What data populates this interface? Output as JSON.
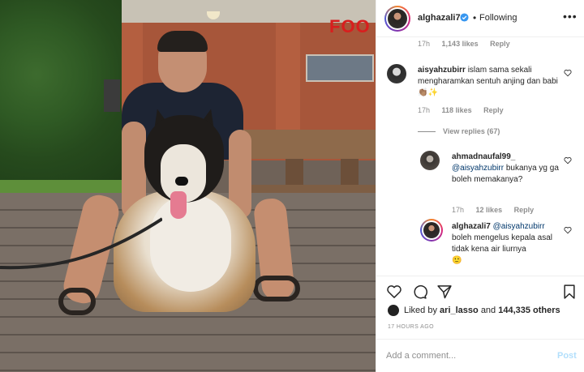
{
  "header": {
    "username": "alghazali7",
    "separator": "•",
    "follow_status": "Following",
    "more_label": "•••"
  },
  "comments": {
    "top_meta": {
      "time": "17h",
      "likes": "1,143 likes",
      "reply": "Reply"
    },
    "items": [
      {
        "username": "aisyahzubirr",
        "text": "islam sama sekali mengharamkan sentuh anjing dan babi",
        "emoji": "👏🏽✨",
        "time": "17h",
        "likes": "118 likes",
        "reply": "Reply",
        "view_replies": "View replies (67)"
      },
      {
        "username": "ahmadnaufal99_",
        "mention": "@aisyahzubirr",
        "text": "bukanya yg ga boleh memakanya?",
        "time": "17h",
        "likes": "12 likes",
        "reply": "Reply"
      },
      {
        "username": "alghazali7",
        "mention": "@aisyahzubirr",
        "text": "boleh mengelus kepala asal tidak kena air liurnya",
        "emoji": "🙂"
      }
    ]
  },
  "actions": {
    "liked_by_prefix": "Liked by",
    "liked_by_user": "ari_lasso",
    "liked_by_and": "and",
    "liked_by_count": "144,335 others",
    "time_ago": "17 HOURS AGO"
  },
  "composer": {
    "placeholder": "Add a comment...",
    "post_label": "Post"
  },
  "photo": {
    "sign_text": "FOO"
  },
  "icons": [
    "verified-icon",
    "heart-icon",
    "comment-icon",
    "share-icon",
    "bookmark-icon",
    "more-icon"
  ],
  "colors": {
    "link": "#00376b",
    "verified": "#3897f0",
    "post_disabled": "#b2dffc",
    "meta": "#8e8e8e"
  }
}
